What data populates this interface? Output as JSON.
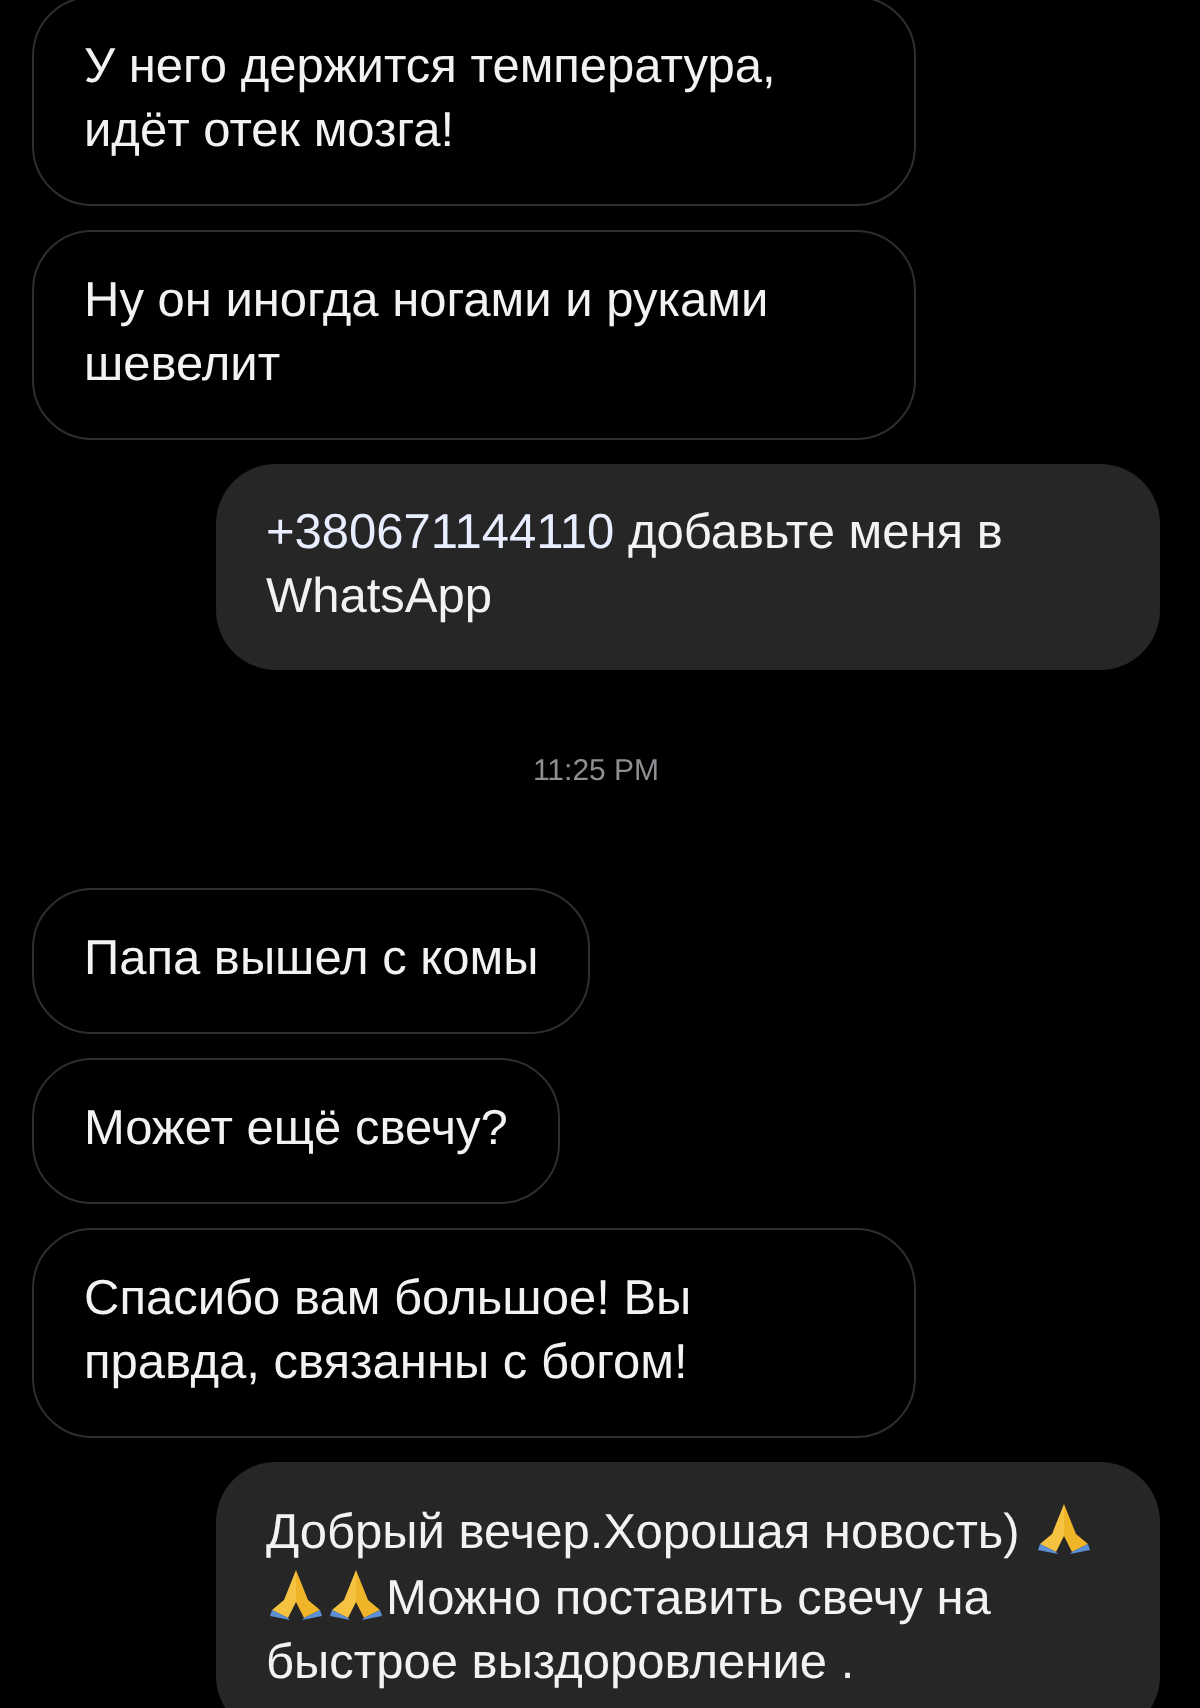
{
  "messages": [
    {
      "kind": "incoming",
      "parts": [
        {
          "kind": "text",
          "text": "У него держится температура, идёт отек мозга!"
        }
      ]
    },
    {
      "kind": "incoming",
      "parts": [
        {
          "kind": "text",
          "text": "Ну он иногда ногами и руками шевелит"
        }
      ]
    },
    {
      "kind": "outgoing",
      "parts": [
        {
          "kind": "link",
          "text": "+380671144110"
        },
        {
          "kind": "text",
          "text": " добавьте меня в WhatsApp"
        }
      ]
    },
    {
      "kind": "timestamp",
      "text": "11:25 PM"
    },
    {
      "kind": "incoming",
      "parts": [
        {
          "kind": "text",
          "text": "Папа вышел с комы"
        }
      ]
    },
    {
      "kind": "incoming",
      "parts": [
        {
          "kind": "text",
          "text": "Может ещё свечу?"
        }
      ]
    },
    {
      "kind": "incoming",
      "parts": [
        {
          "kind": "text",
          "text": "Спасибо вам большое! Вы правда, связанны с богом!"
        }
      ]
    },
    {
      "kind": "outgoing",
      "parts": [
        {
          "kind": "text",
          "text": "Добрый вечер.Хорошая новость) "
        },
        {
          "kind": "emoji"
        },
        {
          "kind": "emoji"
        },
        {
          "kind": "emoji"
        },
        {
          "kind": "text",
          "text": "Можно поставить свечу на быстрое выздоровление ."
        }
      ]
    }
  ]
}
